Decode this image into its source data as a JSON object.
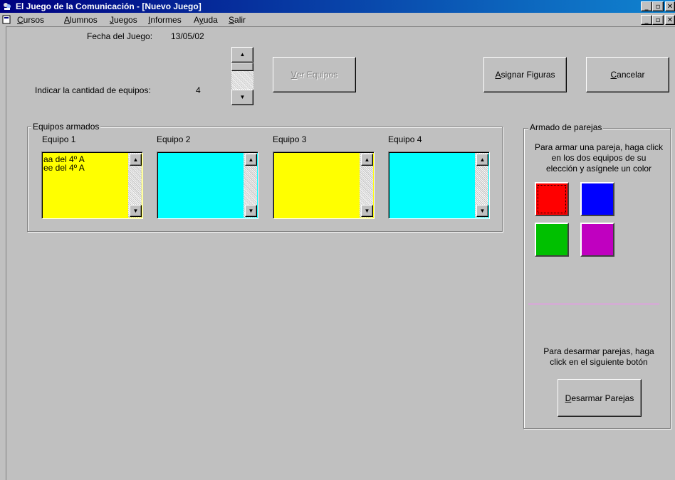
{
  "window": {
    "title": "El Juego de la Comunicación - [Nuevo Juego]",
    "min_label": "_",
    "max_label": "▫",
    "close_label": "✕"
  },
  "menu": [
    {
      "pre": "",
      "ul": "C",
      "post": "ursos"
    },
    {
      "pre": "",
      "ul": "A",
      "post": "lumnos"
    },
    {
      "pre": "",
      "ul": "J",
      "post": "uegos"
    },
    {
      "pre": "",
      "ul": "I",
      "post": "nformes"
    },
    {
      "pre": "A",
      "ul": "y",
      "post": "uda"
    },
    {
      "pre": "",
      "ul": "S",
      "post": "alir"
    }
  ],
  "form": {
    "fecha_label": "Fecha del Juego:",
    "fecha_value": "13/05/02",
    "cantidad_label": "Indicar la cantidad de equipos:",
    "cantidad_value": "4",
    "ver_equipos": {
      "ul": "V",
      "rest": "er Equipos"
    },
    "asignar_figuras": {
      "ul": "A",
      "rest": "signar Figuras"
    },
    "cancelar": {
      "ul": "C",
      "rest": "ancelar"
    }
  },
  "teams_group": {
    "label": "Equipos armados",
    "teams": [
      {
        "label": "Equipo 1",
        "color": "#ffff00",
        "items": [
          "aa del 4º A",
          "ee del 4º A"
        ]
      },
      {
        "label": "Equipo 2",
        "color": "#00ffff",
        "items": []
      },
      {
        "label": "Equipo 3",
        "color": "#ffff00",
        "items": []
      },
      {
        "label": "Equipo 4",
        "color": "#00ffff",
        "items": []
      }
    ]
  },
  "pairs_group": {
    "label": "Armado de parejas",
    "instructions": [
      "Para armar una pareja, haga click",
      "en los dos equipos de su",
      "elección y asígnele un color"
    ],
    "colors": [
      "#ff0000",
      "#0000ff",
      "#00c000",
      "#c000c0"
    ],
    "separator_color": "#ff80ff",
    "undo_text": [
      "Para desarmar parejas, haga",
      "click en el siguiente botón"
    ],
    "desarmar": {
      "ul": "D",
      "rest": "esarmar Parejas"
    }
  }
}
